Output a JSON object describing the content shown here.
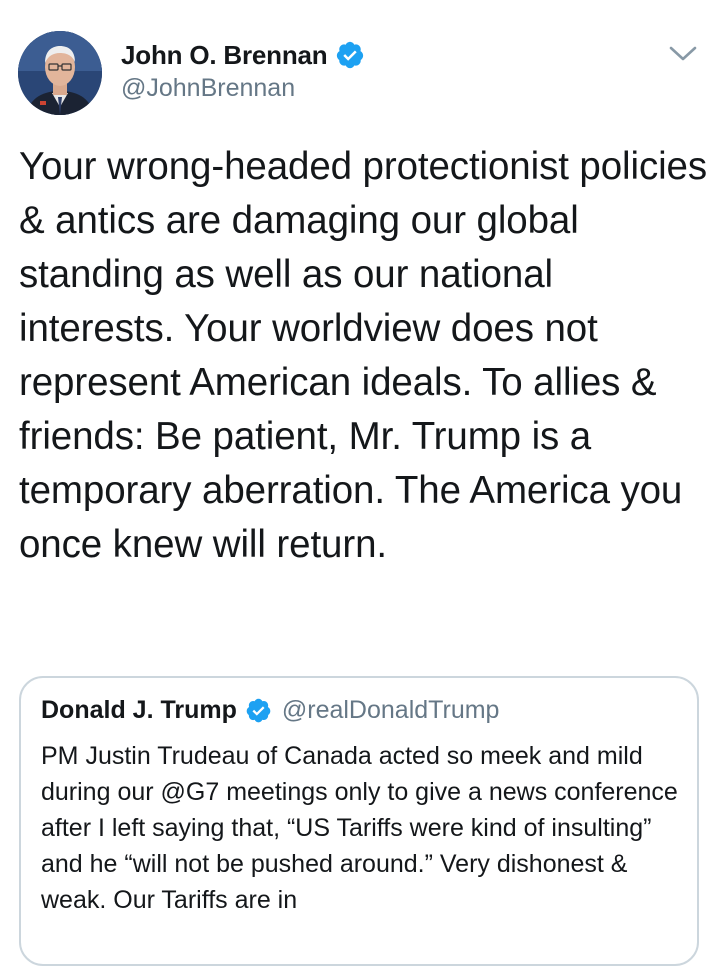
{
  "tweet": {
    "author": {
      "name": "John O. Brennan",
      "handle": "@JohnBrennan",
      "verified": true,
      "avatar_icon": "profile-photo"
    },
    "menu_icon": "chevron-down-icon",
    "text": "Your wrong-headed protectionist policies & antics are damaging our global standing as well as our national interests. Your worldview does not represent American ideals. To allies & friends: Be patient, Mr. Trump is a temporary aberration. The America you once knew will return."
  },
  "quoted_tweet": {
    "author": {
      "name": "Donald J. Trump",
      "handle": "@realDonaldTrump",
      "verified": true
    },
    "text": "PM Justin Trudeau of Canada acted so meek and mild during our @G7 meetings only to give a news conference after I left saying that, “US Tariffs were kind of insulting” and he “will not be pushed around.” Very dishonest & weak. Our Tariffs are in"
  },
  "colors": {
    "text": "#14171a",
    "secondary_text": "#657786",
    "verified_blue": "#1da1f2",
    "border": "#ccd6dd"
  }
}
